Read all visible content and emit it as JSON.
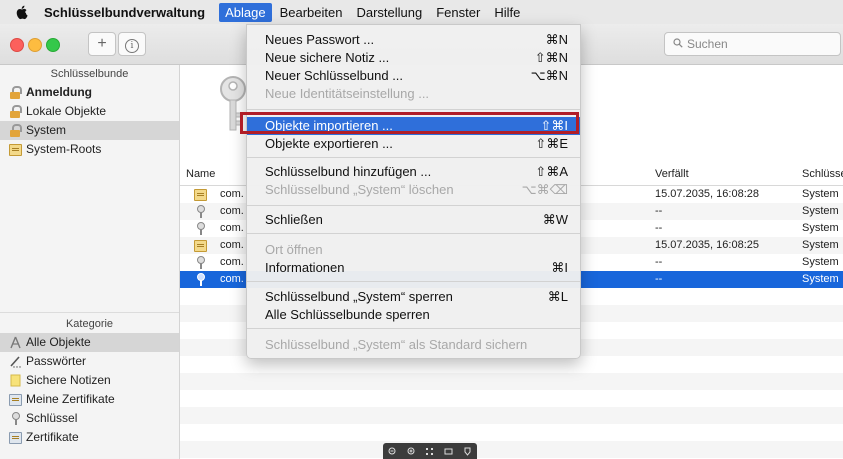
{
  "menubar": {
    "app_name": "Schlüsselbundverwaltung",
    "menus": [
      "Ablage",
      "Bearbeiten",
      "Darstellung",
      "Fenster",
      "Hilfe"
    ]
  },
  "toolbar": {
    "add_label": "+",
    "info_label": "i",
    "search_placeholder": "Suchen"
  },
  "sidebar": {
    "keychains_header": "Schlüsselbunde",
    "keychains": [
      {
        "label": "Anmeldung",
        "icon": "lock-icon"
      },
      {
        "label": "Lokale Objekte",
        "icon": "lock-icon"
      },
      {
        "label": "System",
        "icon": "lock-icon"
      },
      {
        "label": "System-Roots",
        "icon": "certificate-icon"
      }
    ],
    "category_header": "Kategorie",
    "categories": [
      {
        "label": "Alle Objekte",
        "icon": "all-items-icon"
      },
      {
        "label": "Passwörter",
        "icon": "password-icon"
      },
      {
        "label": "Sichere Notizen",
        "icon": "note-icon"
      },
      {
        "label": "Meine Zertifikate",
        "icon": "certificate-icon"
      },
      {
        "label": "Schlüssel",
        "icon": "key-icon"
      },
      {
        "label": "Zertifikate",
        "icon": "certificate-icon"
      }
    ]
  },
  "table": {
    "columns": [
      "Name",
      "Verfällt",
      "Schlüsse"
    ],
    "rows": [
      {
        "name": "com.",
        "icon": "certificate-icon",
        "expires": "15.07.2035, 16:08:28",
        "keychain": "System"
      },
      {
        "name": "com.",
        "icon": "key-icon",
        "expires": "--",
        "keychain": "System"
      },
      {
        "name": "com.",
        "icon": "key-icon",
        "expires": "--",
        "keychain": "System"
      },
      {
        "name": "com.",
        "icon": "certificate-icon",
        "expires": "15.07.2035, 16:08:25",
        "keychain": "System"
      },
      {
        "name": "com.",
        "icon": "key-icon",
        "expires": "--",
        "keychain": "System"
      },
      {
        "name": "com.",
        "icon": "key-icon",
        "expires": "--",
        "keychain": "System"
      }
    ]
  },
  "ablage_menu": {
    "items": [
      {
        "label": "Neues Passwort ...",
        "shortcut": "⌘N"
      },
      {
        "label": "Neue sichere Notiz ...",
        "shortcut": "⇧⌘N"
      },
      {
        "label": "Neuer Schlüsselbund ...",
        "shortcut": "⌥⌘N"
      },
      {
        "label": "Neue Identitätseinstellung ...",
        "shortcut": ""
      },
      {
        "label": "Objekte importieren ...",
        "shortcut": "⇧⌘I"
      },
      {
        "label": "Objekte exportieren ...",
        "shortcut": "⇧⌘E"
      },
      {
        "label": "Schlüsselbund hinzufügen ...",
        "shortcut": "⇧⌘A"
      },
      {
        "label": "Schlüsselbund „System“ löschen",
        "shortcut": "⌥⌘⌫"
      },
      {
        "label": "Schließen",
        "shortcut": "⌘W"
      },
      {
        "label": "Ort öffnen",
        "shortcut": ""
      },
      {
        "label": "Informationen",
        "shortcut": "⌘I"
      },
      {
        "label": "Schlüsselbund „System“ sperren",
        "shortcut": "⌘L"
      },
      {
        "label": "Alle Schlüsselbunde sperren",
        "shortcut": ""
      },
      {
        "label": "Schlüsselbund „System“ als Standard sichern",
        "shortcut": ""
      }
    ]
  },
  "zoombar": {
    "icons": [
      "zoom-out-icon",
      "zoom-in-icon",
      "fit-icon",
      "image-icon",
      "pin-icon"
    ]
  },
  "colors": {
    "accent": "#2f6fda",
    "selection": "#1866db",
    "highlight_box": "#b11d27"
  }
}
